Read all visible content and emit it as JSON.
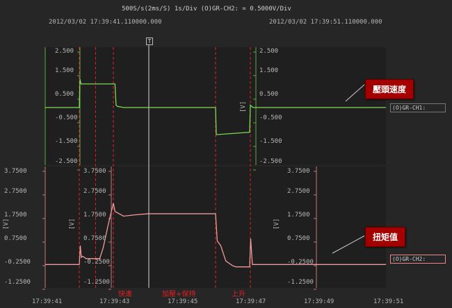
{
  "header": {
    "scale_info": "500S/s(2ms/S)   1s/Div   (O)GR-CH2: = 0.5000V/Div",
    "time_left": "2012/03/02 17:39:41.110000.000",
    "time_right": "2012/03/02 17:39:51.110000.000"
  },
  "trigger_label": "T",
  "ch1": {
    "ticks": [
      "2.500",
      "1.500",
      "0.500",
      "-0.500",
      "-1.500",
      "-2.500"
    ],
    "unit": "[V]",
    "annotation": "壓頭速度",
    "channel_label": "(O)GR-CH1:"
  },
  "ch2": {
    "ticks": [
      "3.7500",
      "2.7500",
      "1.7500",
      "0.7500",
      "-0.2500",
      "-1.2500"
    ],
    "unit": "[V]",
    "annotation": "扭矩值",
    "channel_label": "(O)GR-CH2:"
  },
  "x_ticks": [
    "17:39:41",
    "17:39:43",
    "17:39:45",
    "17:39:47",
    "17:39:49",
    "17:39:51"
  ],
  "markers": [
    "快進",
    "加壓+保持",
    "上升"
  ],
  "colors": {
    "ch1": "#7ed957",
    "ch2": "#f09a9a",
    "marker": "#e02020",
    "annotation": "#a40000"
  },
  "chart_data": [
    {
      "type": "line",
      "title": "",
      "xlabel": "",
      "ylabel": "[V]",
      "ylim": [
        -2.5,
        2.5
      ],
      "x_range": [
        "17:39:41",
        "17:39:51"
      ],
      "series": [
        {
          "name": "壓頭速度",
          "x": [
            0,
            1.0,
            1.02,
            1.05,
            1.1,
            1.4,
            1.55,
            2.05,
            2.08,
            2.12,
            2.3,
            5.0,
            5.02,
            6.0,
            6.02,
            6.1,
            10.0
          ],
          "y": [
            0.0,
            0.0,
            1.2,
            1.0,
            1.0,
            1.0,
            1.0,
            1.0,
            0.1,
            0.05,
            0.0,
            0.0,
            -1.15,
            -1.05,
            0.1,
            0.0,
            0.0
          ]
        }
      ]
    },
    {
      "type": "line",
      "title": "",
      "xlabel": "",
      "ylabel": "[V]",
      "ylim": [
        -1.25,
        3.75
      ],
      "x_range": [
        "17:39:41",
        "17:39:51"
      ],
      "series": [
        {
          "name": "扭矩值",
          "x": [
            0,
            1.0,
            1.03,
            1.06,
            1.1,
            1.2,
            1.6,
            1.7,
            1.85,
            2.0,
            2.05,
            2.3,
            2.6,
            3.0,
            5.0,
            5.05,
            5.15,
            5.3,
            5.5,
            5.6,
            5.9,
            6.0,
            6.03,
            6.08,
            6.2,
            10.0
          ],
          "y": [
            -0.2,
            -0.2,
            0.6,
            0.1,
            0.15,
            0.05,
            0.05,
            0.5,
            1.5,
            2.4,
            2.05,
            1.85,
            1.9,
            1.95,
            1.95,
            0.8,
            0.6,
            -0.05,
            -0.25,
            -0.3,
            -0.3,
            -0.3,
            0.9,
            -0.2,
            -0.2,
            -0.2
          ]
        }
      ]
    }
  ]
}
